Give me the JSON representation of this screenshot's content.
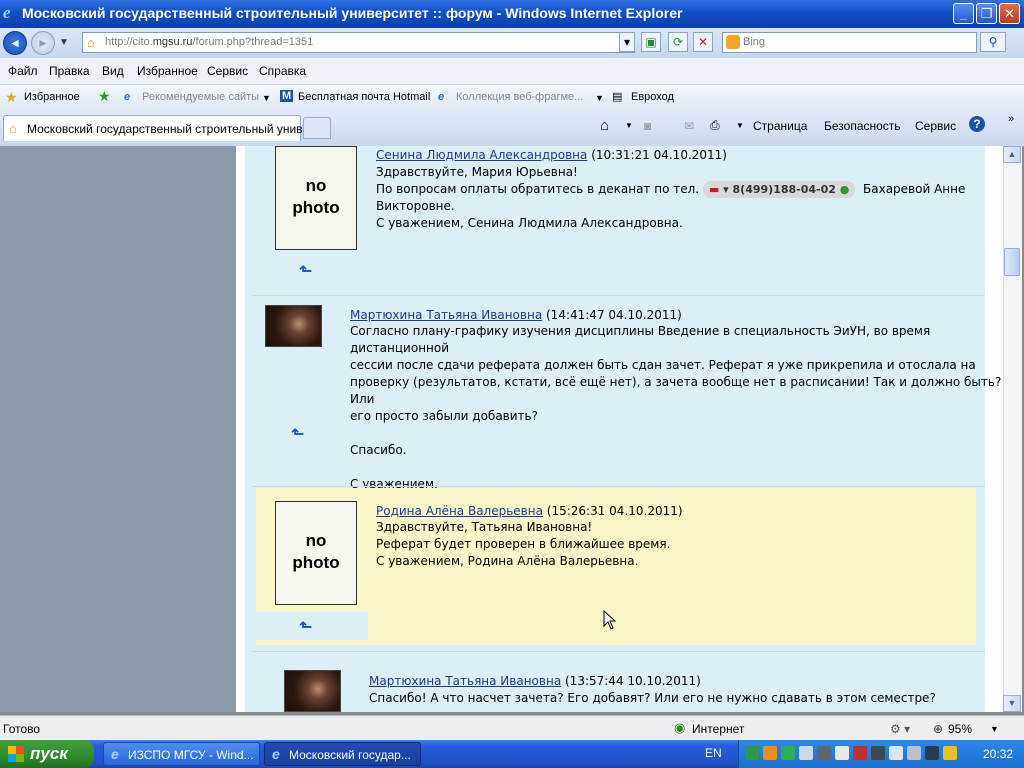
{
  "window": {
    "title": "Московский государственный строительный университет :: форум - Windows Internet Explorer",
    "controls": {
      "minimize": "_",
      "maximize": "❐",
      "close": "✕"
    }
  },
  "navbar": {
    "back_icon": "back-arrow-icon",
    "forward_icon": "forward-arrow-icon",
    "url_prefix": "http://cito.",
    "url_domain": "mgsu.ru",
    "url_rest": "/forum.php?thread=1351",
    "search_placeholder": "Bing"
  },
  "menu": [
    "Файл",
    "Правка",
    "Вид",
    "Избранное",
    "Сервис",
    "Справка"
  ],
  "favorites": {
    "favorites_label": "Избранное",
    "items": [
      "Рекомендуемые сайты",
      "Бесплатная почта Hotmail",
      "Коллекция веб-фрагме...",
      "Евроход"
    ]
  },
  "tabs": {
    "active_tab": "Московский государственный строительный унив...",
    "commands": [
      "Страница",
      "Безопасность",
      "Сервис"
    ]
  },
  "posts": [
    {
      "author": "Сенина Людмила Александровна",
      "timestamp": "(10:31:21 04.10.2011)",
      "avatar_text": [
        "no",
        "photo"
      ],
      "lines": [
        "Здравствуйте, Мария Юрьевна!"
      ],
      "phone_prefix": "По вопросам оплаты обратитесь в деканат по тел.",
      "phone": "8(499)188-04-02",
      "phone_suffix": "Бахаревой Анне",
      "lines_after": "Викторовне.\nС уважением, Сенина Людмила Александровна."
    },
    {
      "author": "Мартюхина Татьяна Ивановна",
      "timestamp": "(14:41:47 04.10.2011)",
      "body": "Согласно плану-графику изучения дисциплины Введение в специальность ЭиУН, во время дистанционной\nсессии после сдачи реферата должен быть сдан зачет. Реферат я уже прикрепила и отослала на\nпроверку (результатов, кстати, всё ещё нет), а зачета вообще нет в расписании! Так и должно быть? Или\nего просто забыли добавить?\n\nСпасибо.\n\nС уважением,\nТатьяна."
    },
    {
      "author": "Родина Алёна Валерьевна",
      "timestamp": "(15:26:31 04.10.2011)",
      "avatar_text": [
        "no",
        "photo"
      ],
      "body": "Здравствуйте, Татьяна Ивановна!\nРеферат будет проверен в ближайшее время.\nС уважением, Родина Алёна Валерьевна."
    },
    {
      "author": "Мартюхина Татьяна Ивановна",
      "timestamp": "(13:57:44 10.10.2011)",
      "body": "Спасибо! А что насчет зачета? Его добавят? Или его не нужно сдавать в этом семестре?"
    }
  ],
  "statusbar": {
    "left": "Готово",
    "zone": "Интернет",
    "zoom": "95%"
  },
  "taskbar": {
    "start": "пуск",
    "tasks": [
      "ИЗСПО МГСУ - Wind...",
      "Московский государ..."
    ],
    "lang": "EN",
    "clock": "20:32"
  },
  "colors": {
    "highlight_post": "#f8f6c8",
    "post_bg": "#dceef6",
    "link": "#1f3a8a",
    "titlebar": "#1050c8"
  }
}
